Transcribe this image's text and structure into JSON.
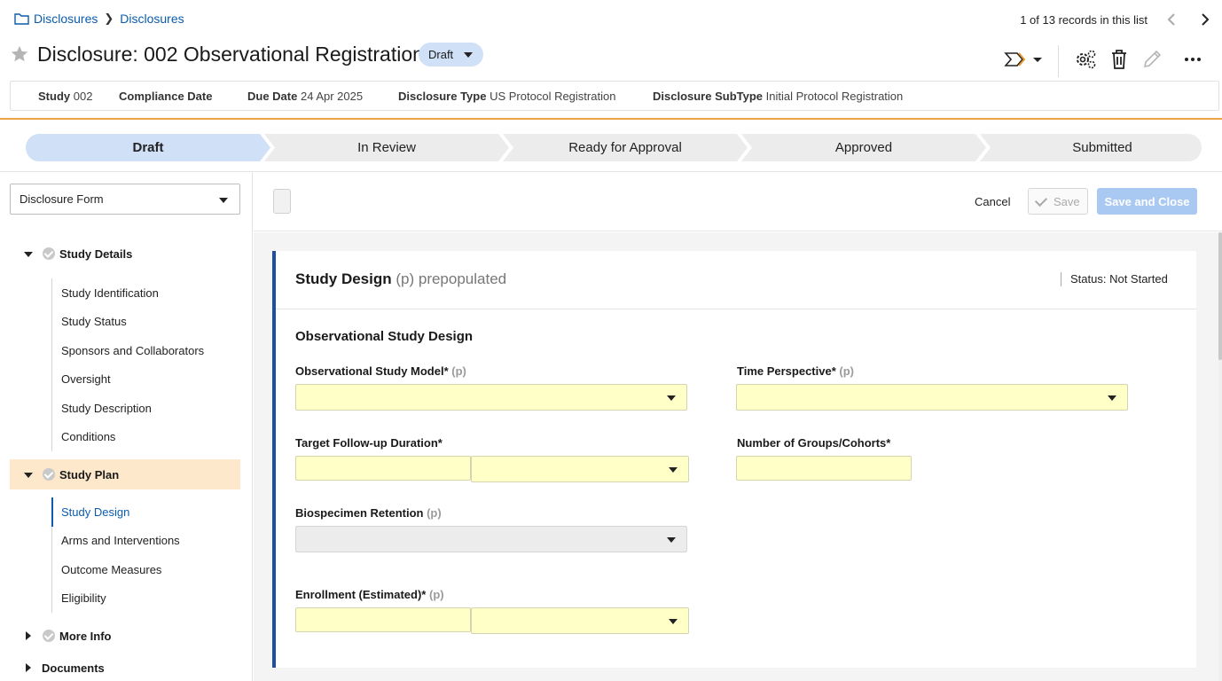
{
  "breadcrumb": {
    "items": [
      "Disclosures",
      "Disclosures"
    ]
  },
  "records": {
    "text": "1 of 13 records in this list"
  },
  "header": {
    "title": "Disclosure: 002 Observational Registration",
    "status": "Draft"
  },
  "info": {
    "study_label": "Study",
    "study_value": "002",
    "compliance_label": "Compliance Date",
    "compliance_value": "",
    "due_label": "Due Date",
    "due_value": "24 Apr 2025",
    "type_label": "Disclosure Type",
    "type_value": "US Protocol Registration",
    "subtype_label": "Disclosure SubType",
    "subtype_value": "Initial Protocol Registration"
  },
  "stepper": {
    "steps": [
      "Draft",
      "In Review",
      "Ready for Approval",
      "Approved",
      "Submitted"
    ],
    "active_index": 0,
    "active_color": "#cfe0f7",
    "inactive_color": "#ececec"
  },
  "sidebar": {
    "form_select": "Disclosure Form",
    "sections": [
      {
        "label": "Study Details",
        "items": [
          "Study Identification",
          "Study Status",
          "Sponsors and Collaborators",
          "Oversight",
          "Study Description",
          "Conditions"
        ]
      },
      {
        "label": "Study Plan",
        "items": [
          "Study Design",
          "Arms and Interventions",
          "Outcome Measures",
          "Eligibility"
        ]
      },
      {
        "label": "More Info",
        "items": []
      },
      {
        "label": "Documents",
        "items": []
      }
    ],
    "active_item": "Study Design"
  },
  "actions": {
    "cancel": "Cancel",
    "save": "Save",
    "save_close": "Save and Close"
  },
  "card": {
    "title": "Study Design",
    "title_suffix": "(p) prepopulated",
    "status": "Status: Not Started",
    "subtitle": "Observational Study Design",
    "fields": {
      "obs_model": {
        "label": "Observational Study Model*",
        "suffix": "(p)",
        "value": ""
      },
      "time_perspective": {
        "label": "Time Perspective*",
        "suffix": "(p)",
        "value": ""
      },
      "followup": {
        "label": "Target Follow-up Duration*",
        "value": "",
        "unit": ""
      },
      "groups": {
        "label": "Number of Groups/Cohorts*",
        "value": ""
      },
      "biospecimen": {
        "label": "Biospecimen Retention",
        "suffix": "(p)",
        "value": ""
      },
      "enrollment": {
        "label": "Enrollment (Estimated)*",
        "suffix": "(p)",
        "value": "",
        "unit": ""
      }
    }
  },
  "colors": {
    "accent": "#0b5cad",
    "orange_rule": "#f0a04b",
    "required_field": "#ffffc8",
    "card_border": "#1f4fa3",
    "highlight_section": "#fde8cc"
  }
}
